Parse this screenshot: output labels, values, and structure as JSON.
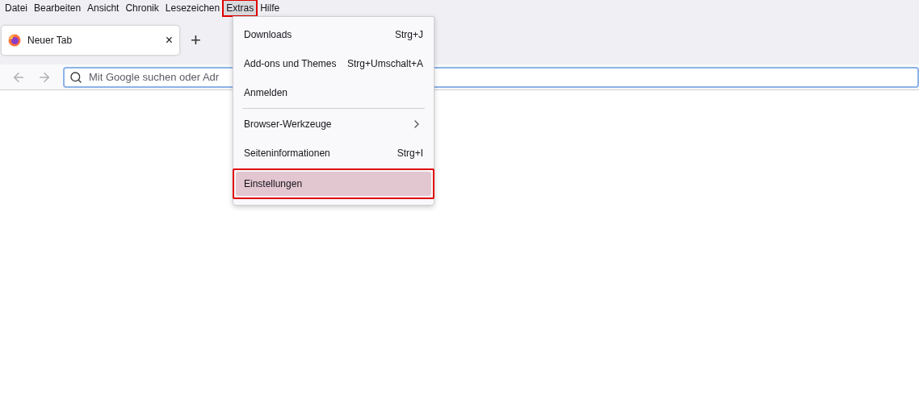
{
  "menubar": [
    {
      "label": "Datei",
      "highlighted": false
    },
    {
      "label": "Bearbeiten",
      "highlighted": false
    },
    {
      "label": "Ansicht",
      "highlighted": false
    },
    {
      "label": "Chronik",
      "highlighted": false
    },
    {
      "label": "Lesezeichen",
      "highlighted": false
    },
    {
      "label": "Extras",
      "highlighted": true
    },
    {
      "label": "Hilfe",
      "highlighted": false
    }
  ],
  "tabs": [
    {
      "title": "Neuer Tab",
      "selected": true,
      "close": "×"
    }
  ],
  "new_tab": "+",
  "address_bar": {
    "placeholder": "Mit Google suchen oder Adr"
  },
  "menu": [
    {
      "kind": "item",
      "label": "Downloads",
      "shortcut": "Strg+J",
      "selected": false,
      "highlighted": false
    },
    {
      "kind": "item",
      "label": "Add-ons und Themes",
      "shortcut": "Strg+Umschalt+A",
      "selected": false,
      "highlighted": false
    },
    {
      "kind": "item",
      "label": "Anmelden",
      "selected": false,
      "highlighted": false
    },
    {
      "kind": "separator"
    },
    {
      "kind": "submenu",
      "label": "Browser-Werkzeuge",
      "selected": false,
      "highlighted": false
    },
    {
      "kind": "item",
      "label": "Seiteninformationen",
      "shortcut": "Strg+I",
      "selected": false,
      "highlighted": false
    },
    {
      "kind": "item",
      "label": "Einstellungen",
      "selected": true,
      "highlighted": true
    }
  ]
}
